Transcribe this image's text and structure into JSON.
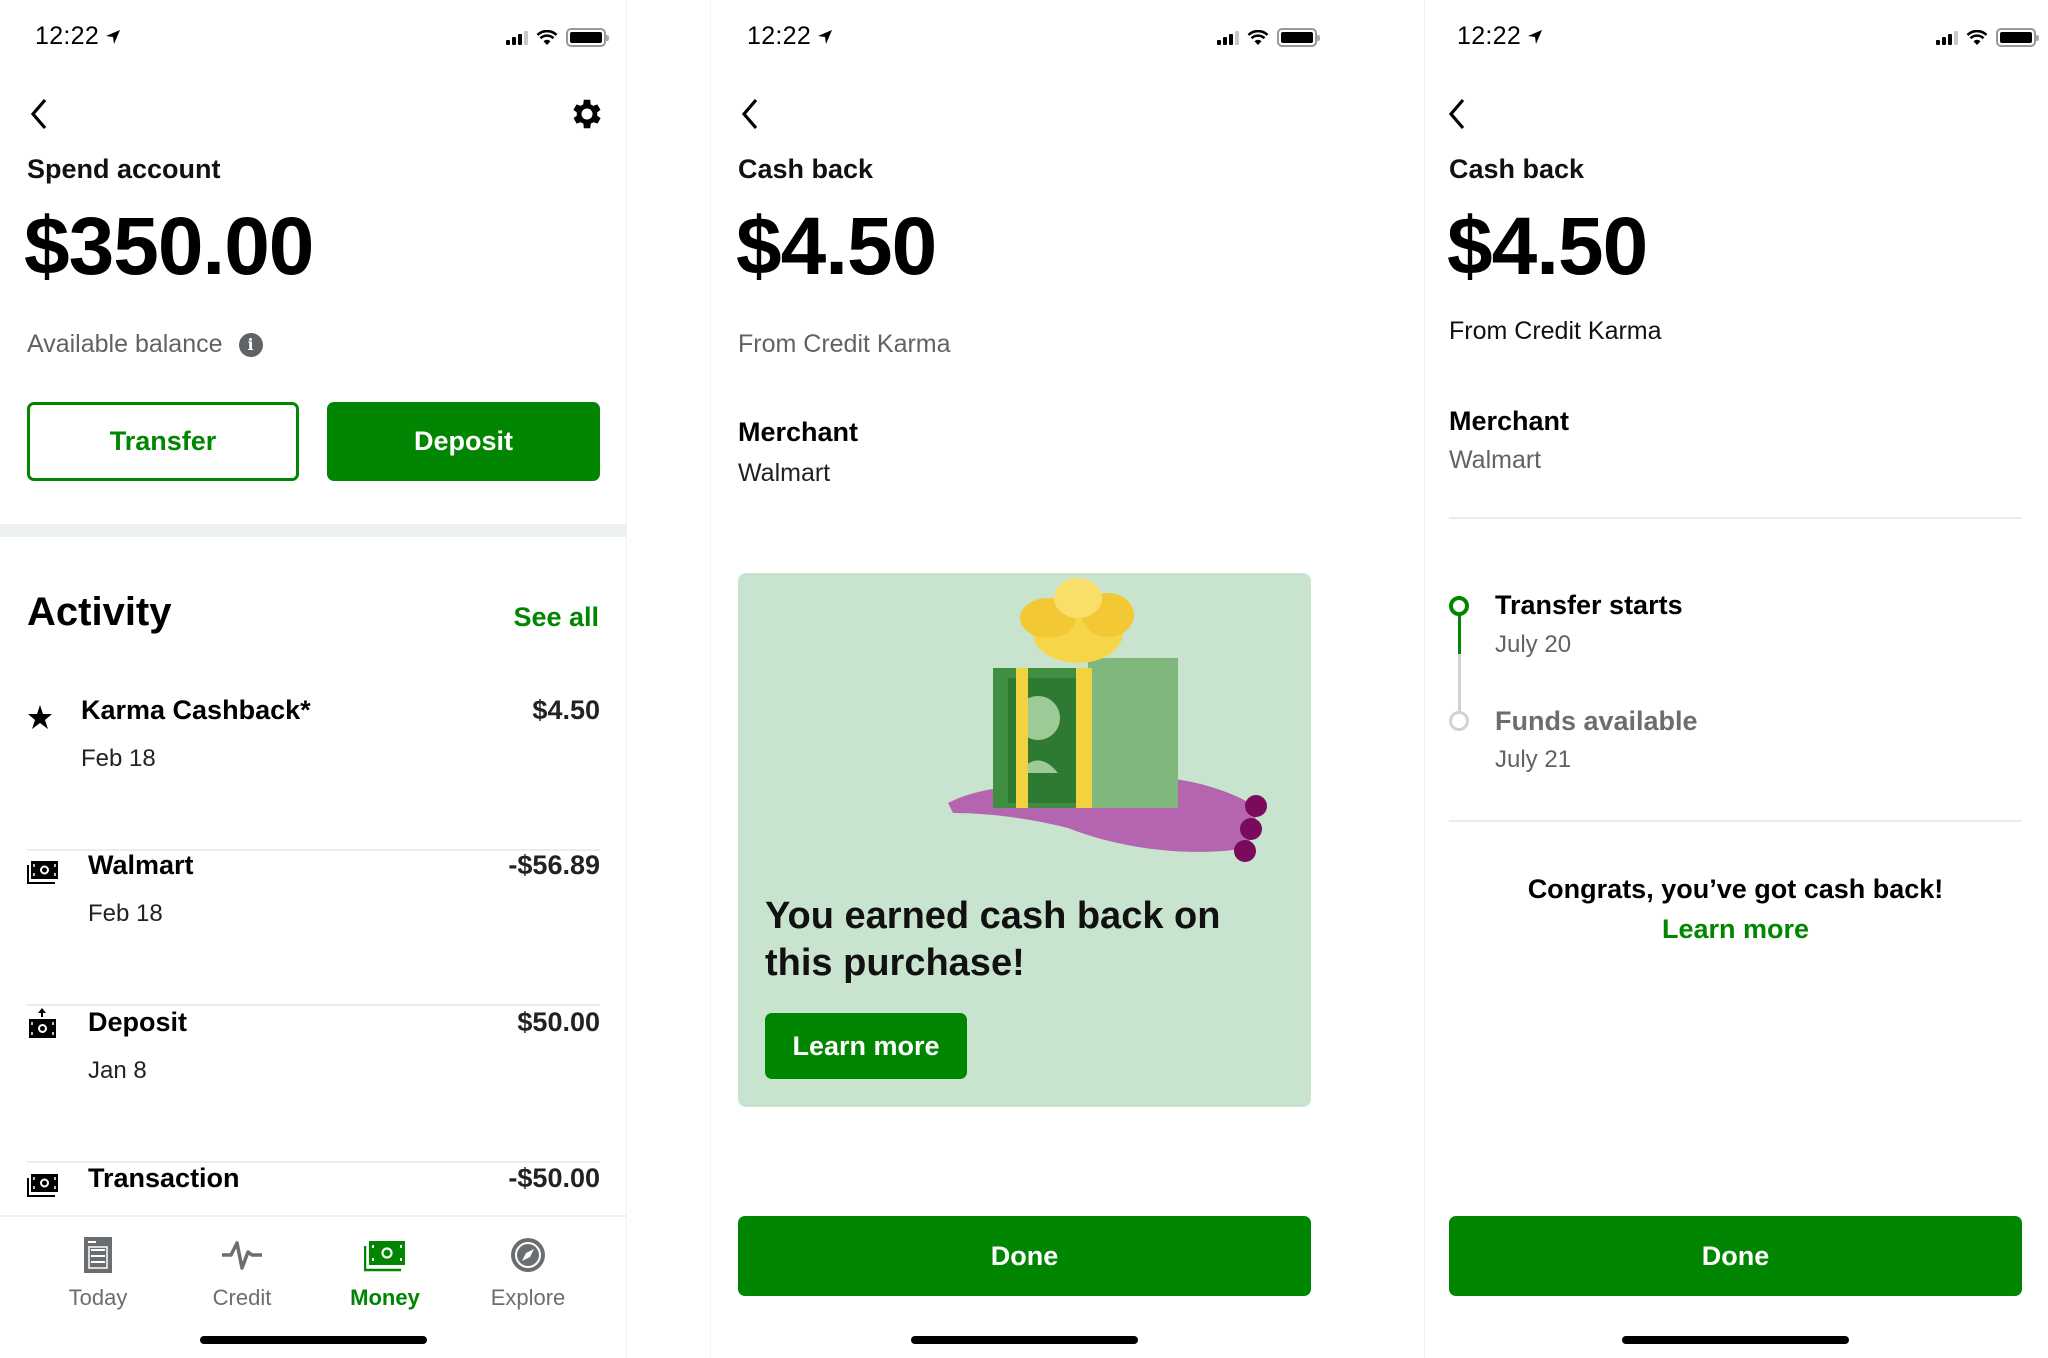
{
  "status_bar": {
    "time": "12:22"
  },
  "spend_screen": {
    "title": "Spend account",
    "balance": "$350.00",
    "balance_label": "Available balance",
    "transfer_label": "Transfer",
    "deposit_label": "Deposit",
    "activity_title": "Activity",
    "see_all_label": "See all",
    "activity": [
      {
        "icon": "star-icon",
        "title": "Karma Cashback*",
        "date": "Feb 18",
        "amount": "$4.50"
      },
      {
        "icon": "cash-icon",
        "title": "Walmart",
        "date": "Feb 18",
        "amount": "-$56.89"
      },
      {
        "icon": "cash-deposit-icon",
        "title": "Deposit",
        "date": "Jan 8",
        "amount": "$50.00"
      },
      {
        "icon": "cash-icon",
        "title": "Transaction",
        "date": "",
        "amount": "-$50.00"
      }
    ],
    "tabs": [
      {
        "icon": "document-icon",
        "label": "Today",
        "active": false
      },
      {
        "icon": "pulse-icon",
        "label": "Credit",
        "active": false
      },
      {
        "icon": "cash-icon",
        "label": "Money",
        "active": true
      },
      {
        "icon": "compass-icon",
        "label": "Explore",
        "active": false
      }
    ]
  },
  "cashback_screen": {
    "title": "Cash back",
    "amount": "$4.50",
    "source": "From Credit Karma",
    "merchant_label": "Merchant",
    "merchant": "Walmart",
    "promo_heading": "You earned cash back on this purchase!",
    "promo_button": "Learn more",
    "done_label": "Done"
  },
  "cashback_detail_screen": {
    "title": "Cash back",
    "amount": "$4.50",
    "source": "From Credit Karma",
    "merchant_label": "Merchant",
    "merchant": "Walmart",
    "timeline": [
      {
        "title": "Transfer starts",
        "date": "July 20",
        "state": "complete"
      },
      {
        "title": "Funds available",
        "date": "July 21",
        "state": "pending"
      }
    ],
    "congrats": "Congrats, you’ve got cash back!",
    "learn_more": "Learn more",
    "done_label": "Done"
  },
  "colors": {
    "brand_green": "#008600",
    "promo_background": "#c9e4ce",
    "muted_text": "#5f6366",
    "divider": "#e8eded"
  }
}
